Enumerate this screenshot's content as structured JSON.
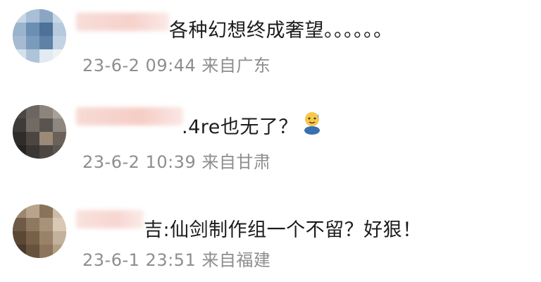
{
  "comments": [
    {
      "text": "各种幻想终成奢望。。。。。。",
      "date": "23-6-2",
      "time": "09:44",
      "location": "来自广东"
    },
    {
      "text": ".4re也无了？",
      "date": "23-6-2",
      "time": "10:39",
      "location": "来自甘肃",
      "emoji": "sweat-smile-emoji"
    },
    {
      "text": "吉:仙剑制作组一个不留？好狠！",
      "date": "23-6-1",
      "time": "23:51",
      "location": "来自福建"
    }
  ],
  "colors": {
    "text": "#1c1c1c",
    "meta": "#8e8e8e",
    "name_blur": "#f3c3bb"
  }
}
